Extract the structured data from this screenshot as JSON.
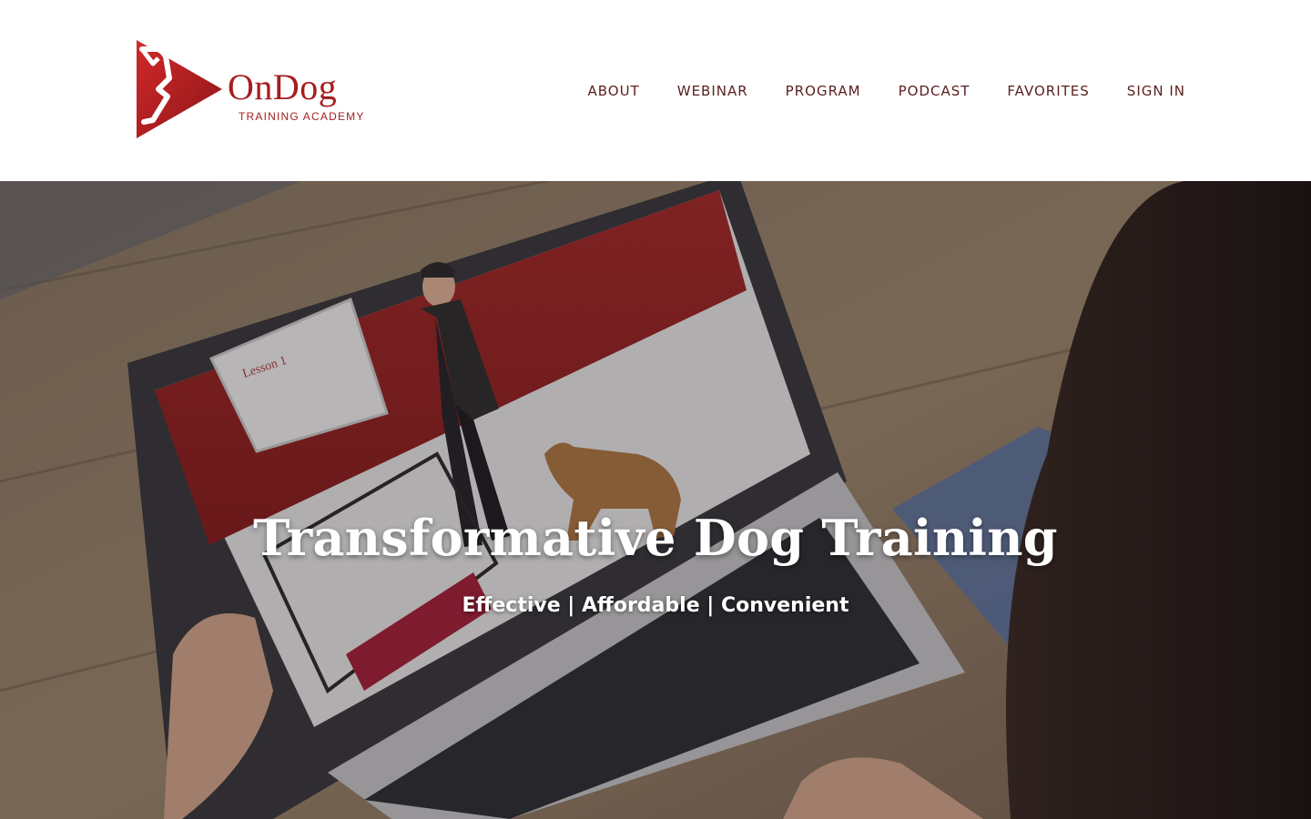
{
  "brand": {
    "name_first": "On",
    "name_second": "Dog",
    "subtitle": "TRAINING ACADEMY",
    "color": "#a51e1f"
  },
  "nav": {
    "items": [
      {
        "label": "ABOUT"
      },
      {
        "label": "WEBINAR"
      },
      {
        "label": "PROGRAM"
      },
      {
        "label": "PODCAST"
      },
      {
        "label": "FAVORITES"
      },
      {
        "label": "SIGN IN"
      }
    ],
    "color": "#5a1e1e"
  },
  "hero": {
    "title": "Transformative Dog Training",
    "tagline": "Effective | Affordable | Convenient",
    "image": "person-watching-dog-training-video-on-laptop",
    "whiteboard_text": "Lesson 1"
  }
}
